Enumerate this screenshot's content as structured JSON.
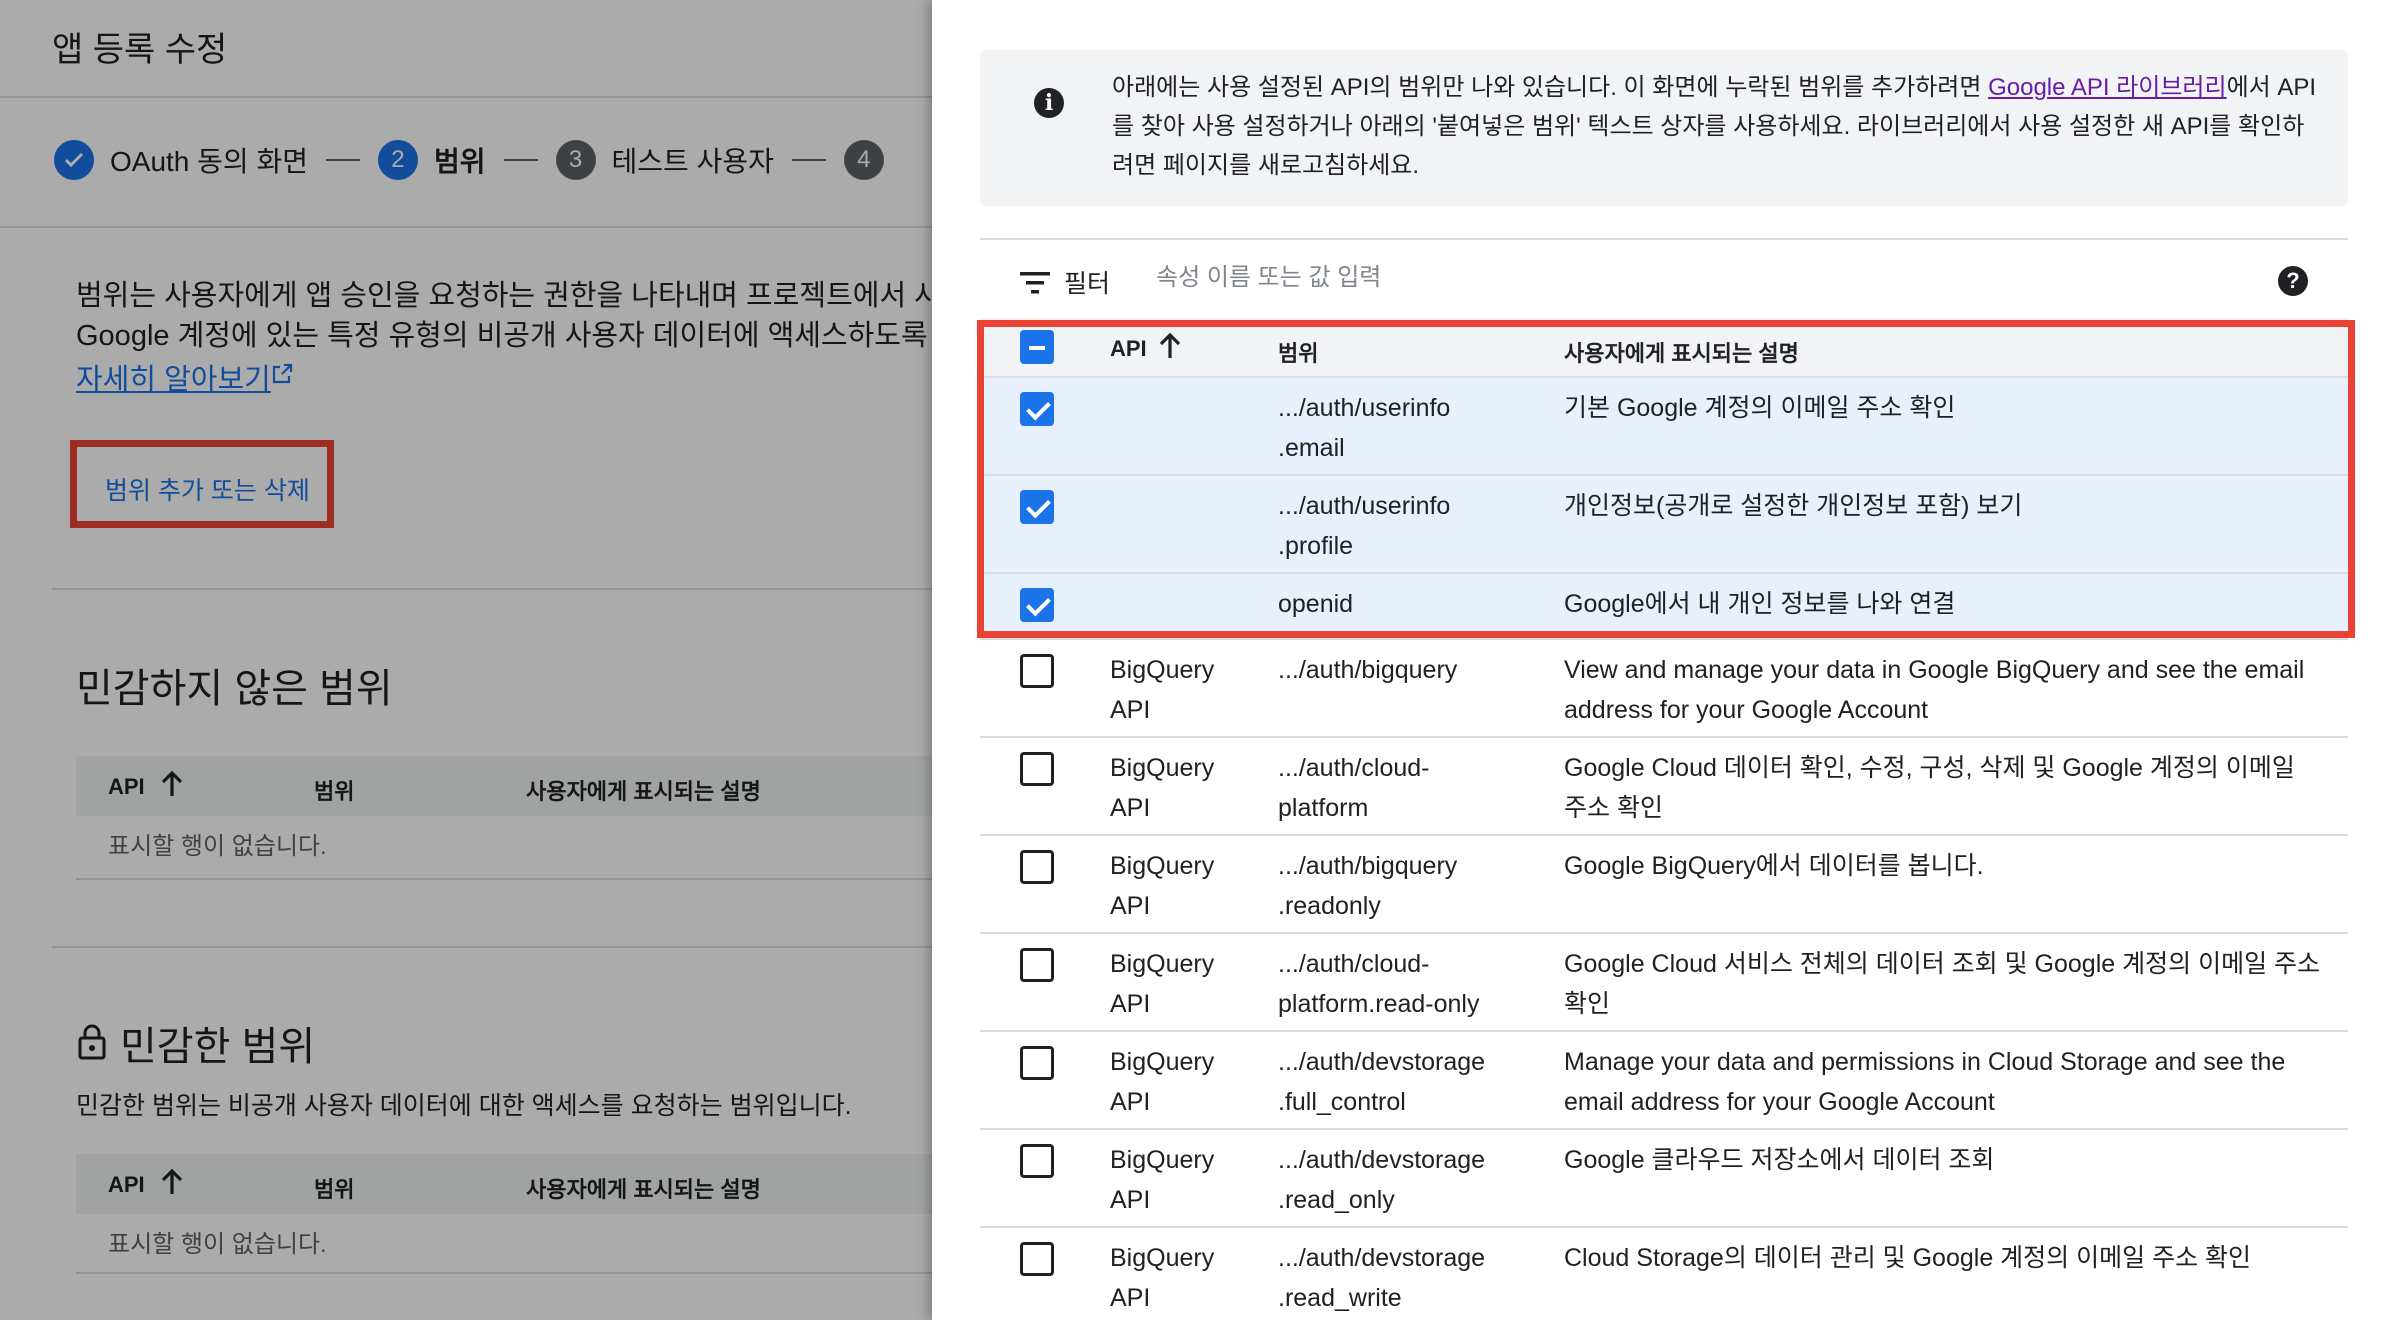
{
  "background_page": {
    "title": "앱 등록 수정",
    "steps": [
      {
        "number": "✓",
        "label": "OAuth 동의 화면",
        "state": "done"
      },
      {
        "number": "2",
        "label": "범위",
        "state": "active"
      },
      {
        "number": "3",
        "label": "테스트 사용자",
        "state": "pending"
      },
      {
        "number": "4",
        "label": "",
        "state": "pending"
      }
    ],
    "description_line1": "범위는 사용자에게 앱 승인을 요청하는 권한을 나타내며 프로젝트에서 사용",
    "description_line2": "Google 계정에 있는 특정 유형의 비공개 사용자 데이터에 액세스하도록 허",
    "learn_more": "자세히 알아보기",
    "add_remove_scopes": "범위 추가 또는 삭제",
    "non_sensitive": {
      "title": "민감하지 않은 범위",
      "columns": [
        "API",
        "범위",
        "사용자에게 표시되는 설명"
      ],
      "empty": "표시할 행이 없습니다."
    },
    "sensitive": {
      "title": "민감한 범위",
      "subtitle": "민감한 범위는 비공개 사용자 데이터에 대한 액세스를 요청하는 범위입니다.",
      "columns": [
        "API",
        "범위",
        "사용자에게 표시되는 설명"
      ],
      "empty": "표시할 행이 없습니다."
    }
  },
  "panel": {
    "info_text_1": "아래에는 사용 설정된 API의 범위만 나와 있습니다. 이 화면에 누락된 범위를 추가하려면 ",
    "info_link": "Google API 라이브러리",
    "info_text_2": "에서 API를 찾아 사용 설정하거나 아래의 '붙여넣은 범위' 텍스트 상자를 사용하세요. 라이브러리에서 사용 설정한 새 API를 확인하려면 페이지를 새로고침하세요.",
    "filter_label": "필터",
    "filter_placeholder": "속성 이름 또는 값 입력",
    "columns": {
      "api": "API",
      "scope": "범위",
      "desc": "사용자에게 표시되는 설명"
    },
    "rows": [
      {
        "checked": true,
        "api": "",
        "scope_l1": ".../auth/userinfo",
        "scope_l2": ".email",
        "desc": "기본 Google 계정의 이메일 주소 확인"
      },
      {
        "checked": true,
        "api": "",
        "scope_l1": ".../auth/userinfo",
        "scope_l2": ".profile",
        "desc": "개인정보(공개로 설정한 개인정보 포함) 보기"
      },
      {
        "checked": true,
        "api": "",
        "scope_l1": "openid",
        "scope_l2": "",
        "desc": "Google에서 내 개인 정보를 나와 연결"
      },
      {
        "checked": false,
        "api": "BigQuery API",
        "scope_l1": ".../auth/bigquery",
        "scope_l2": "",
        "desc": "View and manage your data in Google BigQuery and see the email address for your Google Account"
      },
      {
        "checked": false,
        "api": "BigQuery API",
        "scope_l1": ".../auth/cloud-",
        "scope_l2": "platform",
        "desc": "Google Cloud 데이터 확인, 수정, 구성, 삭제 및 Google 계정의 이메일 주소 확인"
      },
      {
        "checked": false,
        "api": "BigQuery API",
        "scope_l1": ".../auth/bigquery",
        "scope_l2": ".readonly",
        "desc": "Google BigQuery에서 데이터를 봅니다."
      },
      {
        "checked": false,
        "api": "BigQuery API",
        "scope_l1": ".../auth/cloud-",
        "scope_l2": "platform.read-only",
        "desc": "Google Cloud 서비스 전체의 데이터 조회 및 Google 계정의 이메일 주소 확인"
      },
      {
        "checked": false,
        "api": "BigQuery API",
        "scope_l1": ".../auth/devstorage",
        "scope_l2": ".full_control",
        "desc": "Manage your data and permissions in Cloud Storage and see the email address for your Google Account"
      },
      {
        "checked": false,
        "api": "BigQuery API",
        "scope_l1": ".../auth/devstorage",
        "scope_l2": ".read_only",
        "desc": "Google 클라우드 저장소에서 데이터 조회"
      },
      {
        "checked": false,
        "api": "BigQuery API",
        "scope_l1": ".../auth/devstorage",
        "scope_l2": ".read_write",
        "desc": "Cloud Storage의 데이터 관리 및 Google 계정의 이메일 주소 확인"
      }
    ]
  },
  "colors": {
    "primary": "#1a73e8",
    "highlight_border": "#ea4335",
    "selected_row": "#e8f0fe",
    "link_visited": "#681da8"
  }
}
